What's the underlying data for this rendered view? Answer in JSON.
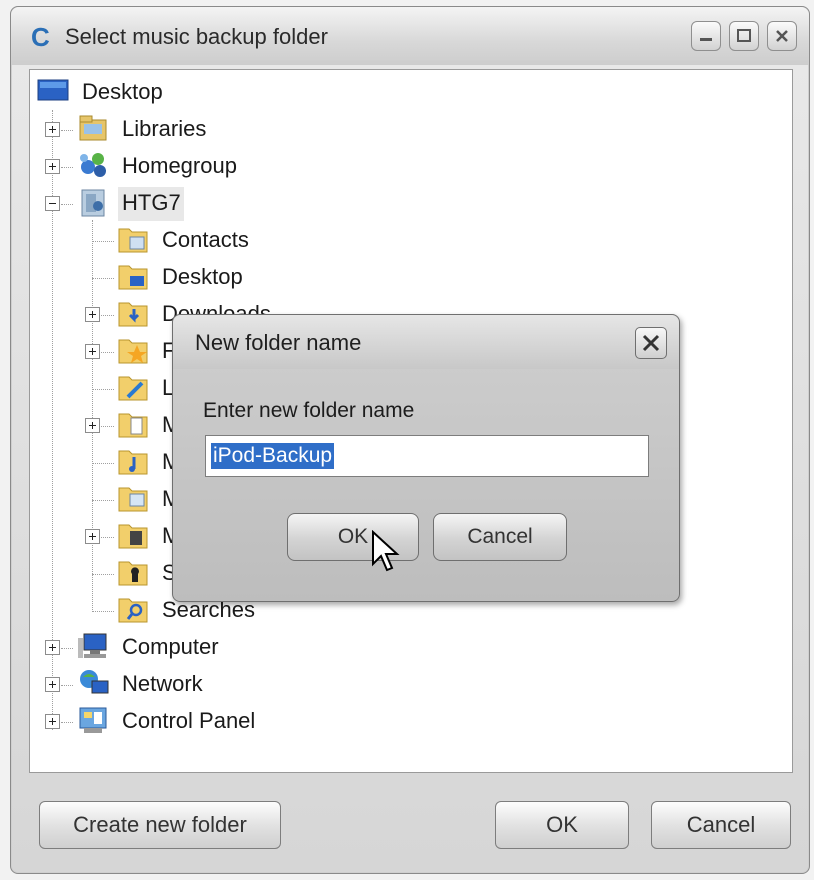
{
  "window": {
    "title": "Select music backup folder",
    "app_icon_letter": "C"
  },
  "tree": {
    "items": [
      {
        "label": "Desktop",
        "icon": "desktop-icon"
      },
      {
        "label": "Libraries",
        "icon": "libraries-icon"
      },
      {
        "label": "Homegroup",
        "icon": "homegroup-icon"
      },
      {
        "label": "HTG7",
        "icon": "user-folder-icon"
      },
      {
        "label": "Contacts",
        "icon": "contacts-folder-icon"
      },
      {
        "label": "Desktop",
        "icon": "desktop-folder-icon"
      },
      {
        "label": "Downloads",
        "icon": "downloads-folder-icon"
      },
      {
        "label": "F",
        "icon": "favorites-folder-icon"
      },
      {
        "label": "Li",
        "icon": "links-folder-icon"
      },
      {
        "label": "M",
        "icon": "documents-folder-icon"
      },
      {
        "label": "M",
        "icon": "music-folder-icon"
      },
      {
        "label": "M",
        "icon": "pictures-folder-icon"
      },
      {
        "label": "M",
        "icon": "videos-folder-icon"
      },
      {
        "label": "S",
        "icon": "saved-games-folder-icon"
      },
      {
        "label": "Searches",
        "icon": "searches-folder-icon"
      },
      {
        "label": "Computer",
        "icon": "computer-icon"
      },
      {
        "label": "Network",
        "icon": "network-icon"
      },
      {
        "label": "Control Panel",
        "icon": "control-panel-icon"
      }
    ]
  },
  "buttons": {
    "create_new_folder": "Create new folder",
    "ok": "OK",
    "cancel": "Cancel"
  },
  "dialog": {
    "title": "New folder name",
    "prompt": "Enter new folder name",
    "input_value": "iPod-Backup",
    "ok": "OK",
    "cancel": "Cancel"
  },
  "colors": {
    "selection": "#2f6ec8",
    "app_icon": "#2b6fb6"
  }
}
